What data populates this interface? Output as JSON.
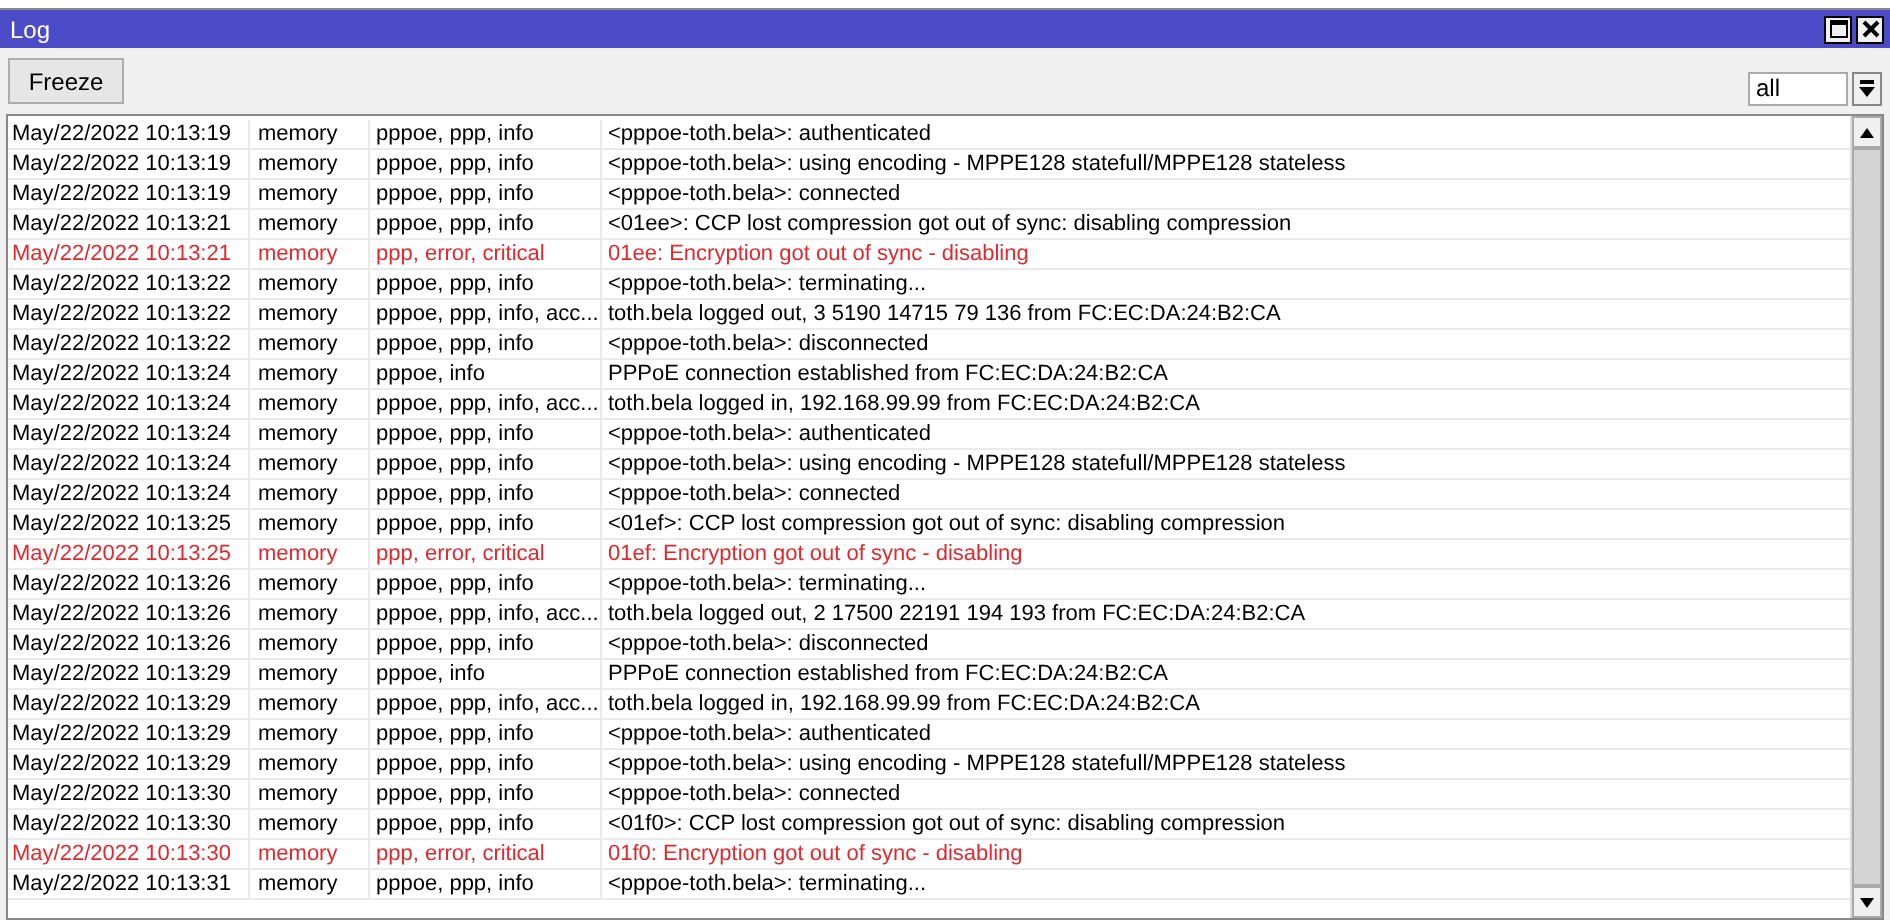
{
  "window": {
    "title": "Log"
  },
  "toolbar": {
    "freeze_button": "Freeze",
    "filter": {
      "value": "all"
    }
  },
  "rows": [
    {
      "time": "May/22/2022 10:13:19",
      "buffer": "memory",
      "topics": "pppoe, ppp, info",
      "message": "<pppoe-toth.bela>: authenticated",
      "error": false
    },
    {
      "time": "May/22/2022 10:13:19",
      "buffer": "memory",
      "topics": "pppoe, ppp, info",
      "message": "<pppoe-toth.bela>: using encoding - MPPE128 statefull/MPPE128 stateless",
      "error": false
    },
    {
      "time": "May/22/2022 10:13:19",
      "buffer": "memory",
      "topics": "pppoe, ppp, info",
      "message": "<pppoe-toth.bela>: connected",
      "error": false
    },
    {
      "time": "May/22/2022 10:13:21",
      "buffer": "memory",
      "topics": "pppoe, ppp, info",
      "message": "<01ee>: CCP lost compression got out of sync: disabling compression",
      "error": false
    },
    {
      "time": "May/22/2022 10:13:21",
      "buffer": "memory",
      "topics": "ppp, error, critical",
      "message": "01ee: Encryption got out of sync - disabling",
      "error": true
    },
    {
      "time": "May/22/2022 10:13:22",
      "buffer": "memory",
      "topics": "pppoe, ppp, info",
      "message": "<pppoe-toth.bela>: terminating...",
      "error": false
    },
    {
      "time": "May/22/2022 10:13:22",
      "buffer": "memory",
      "topics": "pppoe, ppp, info, acc...",
      "message": "toth.bela logged out, 3 5190 14715 79 136 from FC:EC:DA:24:B2:CA",
      "error": false
    },
    {
      "time": "May/22/2022 10:13:22",
      "buffer": "memory",
      "topics": "pppoe, ppp, info",
      "message": "<pppoe-toth.bela>: disconnected",
      "error": false
    },
    {
      "time": "May/22/2022 10:13:24",
      "buffer": "memory",
      "topics": "pppoe, info",
      "message": "PPPoE connection established from FC:EC:DA:24:B2:CA",
      "error": false
    },
    {
      "time": "May/22/2022 10:13:24",
      "buffer": "memory",
      "topics": "pppoe, ppp, info, acc...",
      "message": "toth.bela logged in, 192.168.99.99 from FC:EC:DA:24:B2:CA",
      "error": false
    },
    {
      "time": "May/22/2022 10:13:24",
      "buffer": "memory",
      "topics": "pppoe, ppp, info",
      "message": "<pppoe-toth.bela>: authenticated",
      "error": false
    },
    {
      "time": "May/22/2022 10:13:24",
      "buffer": "memory",
      "topics": "pppoe, ppp, info",
      "message": "<pppoe-toth.bela>: using encoding - MPPE128 statefull/MPPE128 stateless",
      "error": false
    },
    {
      "time": "May/22/2022 10:13:24",
      "buffer": "memory",
      "topics": "pppoe, ppp, info",
      "message": "<pppoe-toth.bela>: connected",
      "error": false
    },
    {
      "time": "May/22/2022 10:13:25",
      "buffer": "memory",
      "topics": "pppoe, ppp, info",
      "message": "<01ef>: CCP lost compression got out of sync: disabling compression",
      "error": false
    },
    {
      "time": "May/22/2022 10:13:25",
      "buffer": "memory",
      "topics": "ppp, error, critical",
      "message": "01ef: Encryption got out of sync - disabling",
      "error": true
    },
    {
      "time": "May/22/2022 10:13:26",
      "buffer": "memory",
      "topics": "pppoe, ppp, info",
      "message": "<pppoe-toth.bela>: terminating...",
      "error": false
    },
    {
      "time": "May/22/2022 10:13:26",
      "buffer": "memory",
      "topics": "pppoe, ppp, info, acc...",
      "message": "toth.bela logged out, 2 17500 22191 194 193 from FC:EC:DA:24:B2:CA",
      "error": false
    },
    {
      "time": "May/22/2022 10:13:26",
      "buffer": "memory",
      "topics": "pppoe, ppp, info",
      "message": "<pppoe-toth.bela>: disconnected",
      "error": false
    },
    {
      "time": "May/22/2022 10:13:29",
      "buffer": "memory",
      "topics": "pppoe, info",
      "message": "PPPoE connection established from FC:EC:DA:24:B2:CA",
      "error": false
    },
    {
      "time": "May/22/2022 10:13:29",
      "buffer": "memory",
      "topics": "pppoe, ppp, info, acc...",
      "message": "toth.bela logged in, 192.168.99.99 from FC:EC:DA:24:B2:CA",
      "error": false
    },
    {
      "time": "May/22/2022 10:13:29",
      "buffer": "memory",
      "topics": "pppoe, ppp, info",
      "message": "<pppoe-toth.bela>: authenticated",
      "error": false
    },
    {
      "time": "May/22/2022 10:13:29",
      "buffer": "memory",
      "topics": "pppoe, ppp, info",
      "message": "<pppoe-toth.bela>: using encoding - MPPE128 statefull/MPPE128 stateless",
      "error": false
    },
    {
      "time": "May/22/2022 10:13:30",
      "buffer": "memory",
      "topics": "pppoe, ppp, info",
      "message": "<pppoe-toth.bela>: connected",
      "error": false
    },
    {
      "time": "May/22/2022 10:13:30",
      "buffer": "memory",
      "topics": "pppoe, ppp, info",
      "message": "<01f0>: CCP lost compression got out of sync: disabling compression",
      "error": false
    },
    {
      "time": "May/22/2022 10:13:30",
      "buffer": "memory",
      "topics": "ppp, error, critical",
      "message": "01f0: Encryption got out of sync - disabling",
      "error": true
    },
    {
      "time": "May/22/2022 10:13:31",
      "buffer": "memory",
      "topics": "pppoe, ppp, info",
      "message": "<pppoe-toth.bela>: terminating...",
      "error": false
    }
  ]
}
